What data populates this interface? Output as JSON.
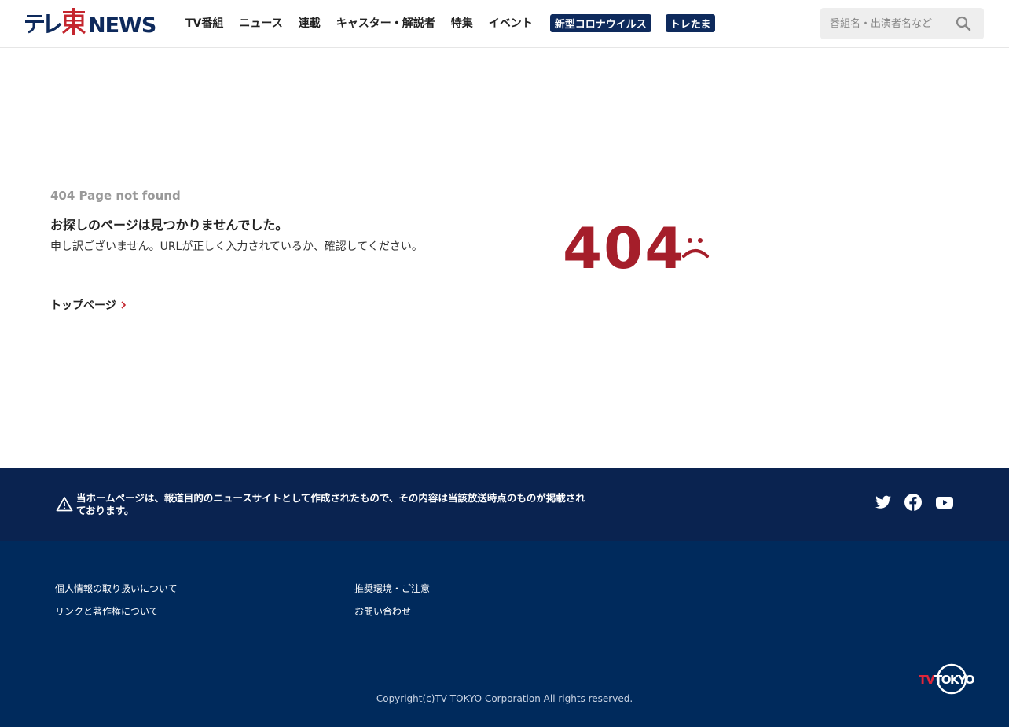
{
  "header": {
    "logo_text": "テレ東NEWS",
    "nav": [
      {
        "label": "TV番組"
      },
      {
        "label": "ニュース"
      },
      {
        "label": "連載"
      },
      {
        "label": "キャスター・解説者"
      },
      {
        "label": "特集"
      },
      {
        "label": "イベント"
      }
    ],
    "badges": [
      {
        "label": "新型コロナウイルス"
      },
      {
        "label": "トレたま"
      }
    ],
    "search": {
      "placeholder": "番組名・出演者名など",
      "value": ""
    }
  },
  "main": {
    "code_label": "404 Page not found",
    "title": "お探しのページは見つかりませんでした。",
    "description": "申し訳ございません。URLが正しく入力されているか、確認してください。",
    "top_link": "トップページ",
    "big_code": "404"
  },
  "notice": {
    "text": "当ホームページは、報道目的のニュースサイトとして作成されたもので、その内容は当該放送時点のものが掲載されております。"
  },
  "footer": {
    "links_col1": [
      "個人情報の取り扱いについて",
      "リンクと著作権について"
    ],
    "links_col2": [
      "推奨環境・ご注意",
      "お問い合わせ"
    ],
    "copyright": "Copyright(c)TV TOKYO Corporation All rights reserved.",
    "logo_text": "TV TOKYO"
  },
  "colors": {
    "brand_red": "#a51e2a",
    "navy": "#0a2350",
    "footer_navy": "#002a5c"
  },
  "icons": {
    "search": "search-icon",
    "warning": "warning-icon",
    "twitter": "twitter-icon",
    "facebook": "facebook-icon",
    "youtube": "youtube-icon",
    "sad_face": "sad-face-icon",
    "chevron": "chevron-right-icon"
  }
}
